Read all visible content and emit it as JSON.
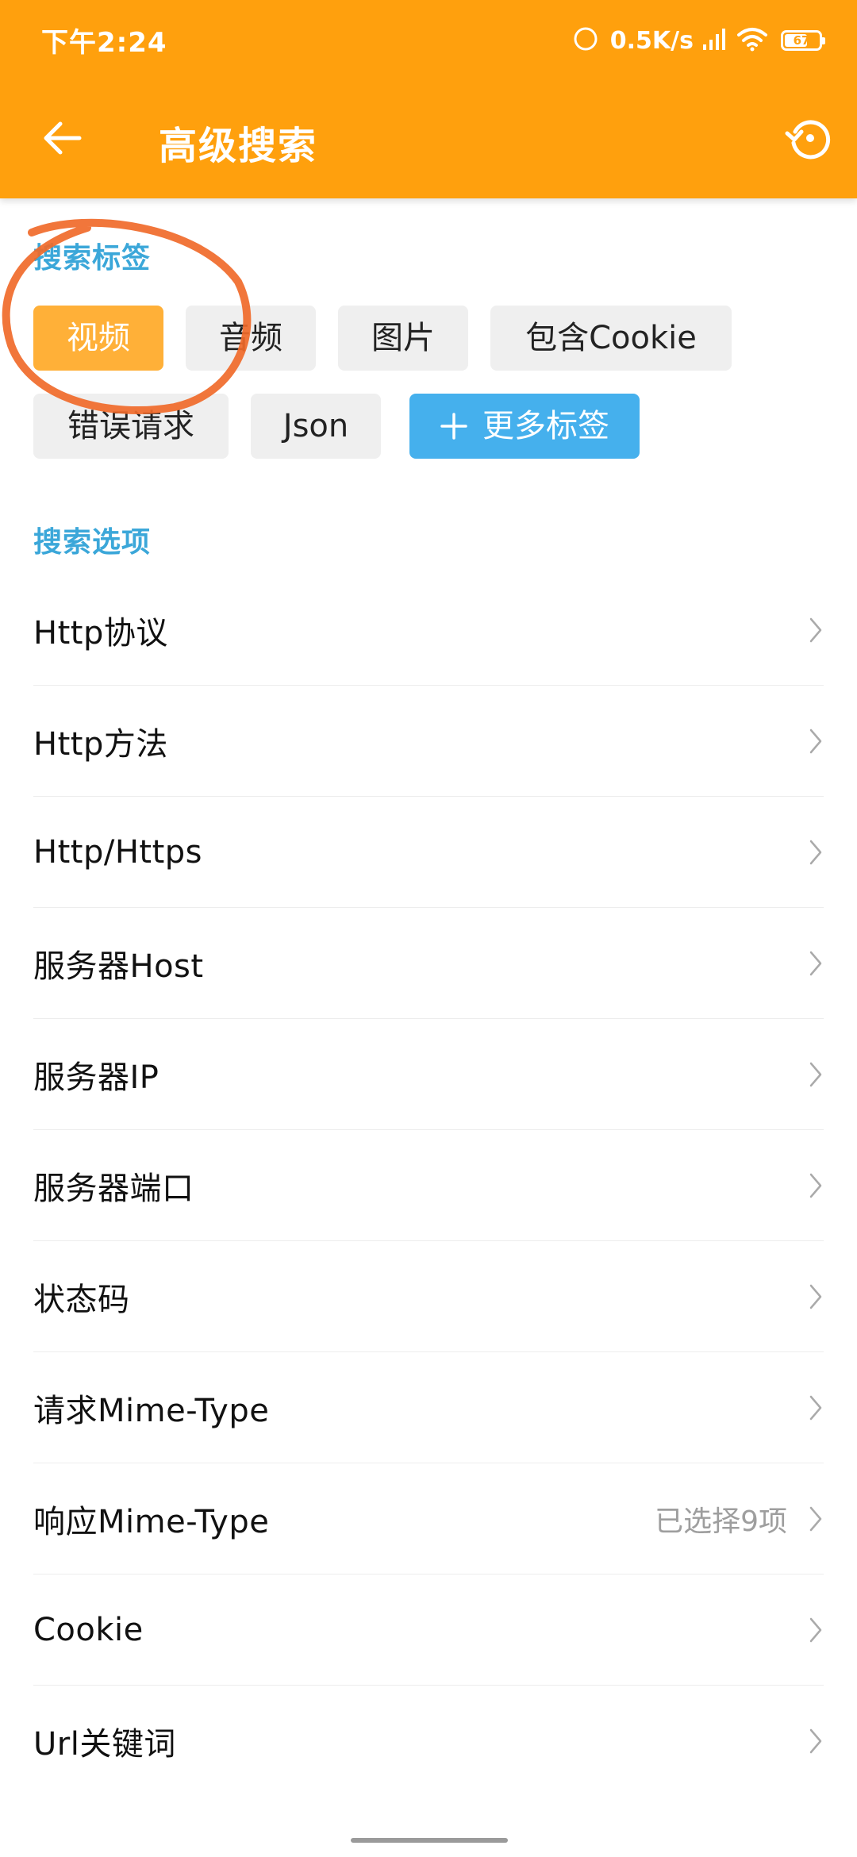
{
  "status_bar": {
    "time": "下午2:24",
    "network_speed": "0.5K/s",
    "battery_level": 67,
    "battery_label": "67"
  },
  "toolbar": {
    "title": "高级搜索",
    "back_icon": "arrow-left-icon",
    "reset_icon": "reset-history-icon"
  },
  "tags_section": {
    "title": "搜索标签",
    "tags": [
      {
        "label": "视频",
        "selected": true
      },
      {
        "label": "音频",
        "selected": false
      },
      {
        "label": "图片",
        "selected": false
      },
      {
        "label": "包含Cookie",
        "selected": false
      },
      {
        "label": "错误请求",
        "selected": false
      },
      {
        "label": "Json",
        "selected": false
      }
    ],
    "more_label": "更多标签",
    "more_icon": "plus-icon"
  },
  "options_section": {
    "title": "搜索选项",
    "items": [
      {
        "label": "Http协议",
        "value": ""
      },
      {
        "label": "Http方法",
        "value": ""
      },
      {
        "label": "Http/Https",
        "value": ""
      },
      {
        "label": "服务器Host",
        "value": ""
      },
      {
        "label": "服务器IP",
        "value": ""
      },
      {
        "label": "服务器端口",
        "value": ""
      },
      {
        "label": "状态码",
        "value": ""
      },
      {
        "label": "请求Mime-Type",
        "value": ""
      },
      {
        "label": "响应Mime-Type",
        "value": "已选择9项"
      },
      {
        "label": "Cookie",
        "value": ""
      },
      {
        "label": "Url关键词",
        "value": ""
      }
    ]
  },
  "colors": {
    "header": "#FFA00D",
    "section_title": "#3BA7D9",
    "tag_selected": "#FFB038",
    "tag_more": "#45B0ED",
    "annotation": "#F06A2A"
  }
}
